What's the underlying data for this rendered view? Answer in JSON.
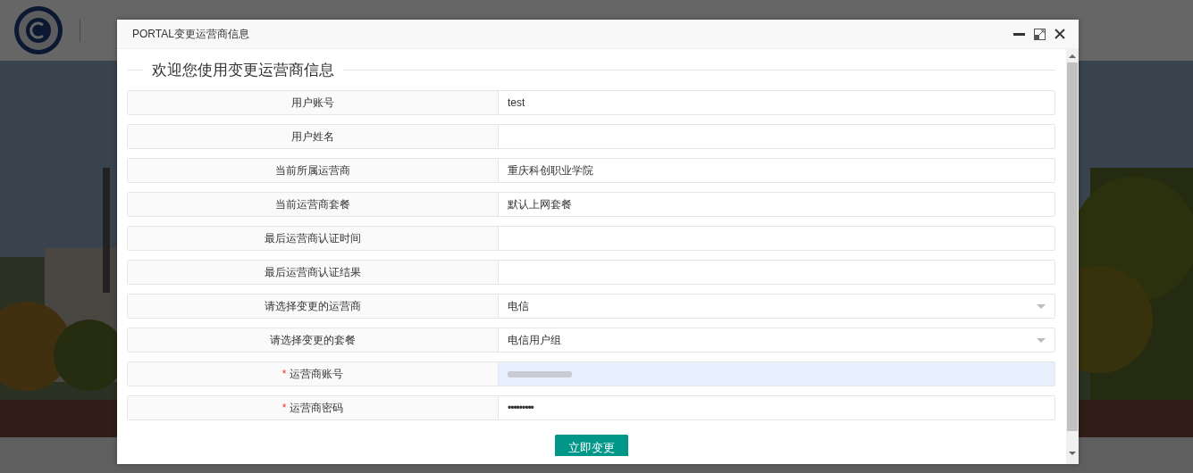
{
  "dialog": {
    "title": "PORTAL变更运营商信息",
    "legend": "欢迎您使用变更运营商信息",
    "fields": [
      {
        "label": "用户账号",
        "kind": "text",
        "value": "test"
      },
      {
        "label": "用户姓名",
        "kind": "text"
      },
      {
        "label": "当前所属运营商",
        "kind": "text",
        "value": "重庆科创职业学院"
      },
      {
        "label": "当前运营商套餐",
        "kind": "text",
        "value": "默认上网套餐"
      },
      {
        "label": "最后运营商认证时间",
        "kind": "text"
      },
      {
        "label": "最后运营商认证结果",
        "kind": "text"
      },
      {
        "label": "请选择变更的运营商",
        "kind": "select",
        "value": "电信"
      },
      {
        "label": "请选择变更的套餐",
        "kind": "select",
        "value": "电信用户组"
      },
      {
        "label": "运营商账号",
        "kind": "redacted",
        "required_mark": "*"
      },
      {
        "label": "运营商密码",
        "kind": "password",
        "required_mark": "*",
        "value": "•••••••••"
      }
    ],
    "submit": "立即变更"
  }
}
